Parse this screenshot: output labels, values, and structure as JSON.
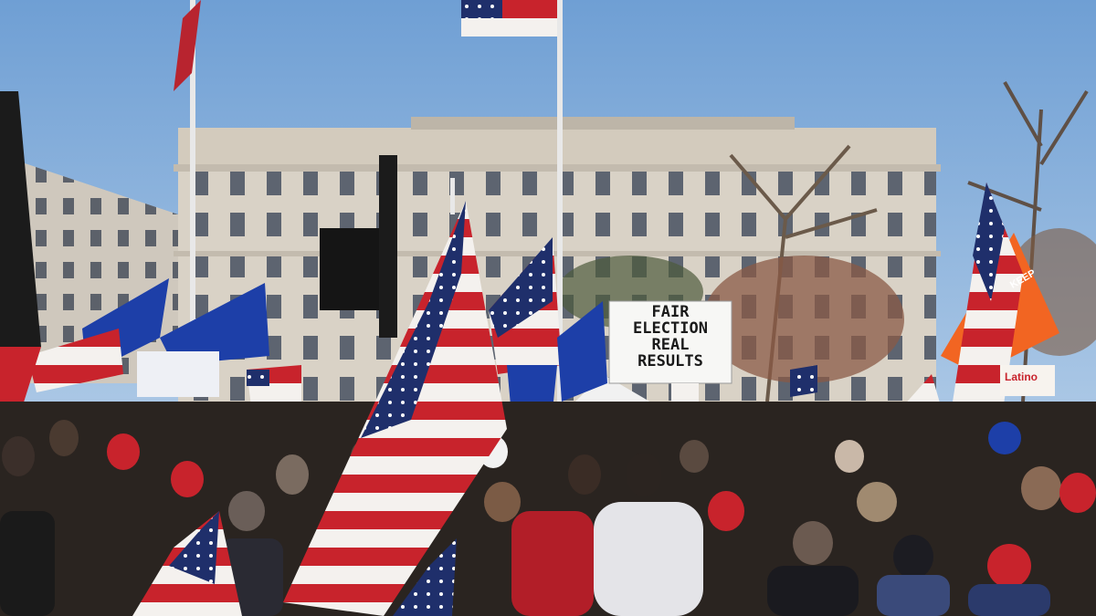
{
  "scene": {
    "description_free": true
  },
  "sign_main": {
    "line1": "FAIR",
    "line2": "ELECTION",
    "line3": "REAL",
    "line4": "RESULTS"
  },
  "sign_latino": {
    "text": "Latino"
  },
  "banner_keep": {
    "text": "KEEP"
  },
  "colors": {
    "sky_top": "#6f9fd4",
    "sky_bottom": "#c9dcee",
    "building": "#d9d2c6",
    "flag_red": "#c8232c",
    "flag_blue": "#1f2f6b",
    "trump_blue": "#1d3fa8",
    "orange_flag": "#f26522"
  }
}
